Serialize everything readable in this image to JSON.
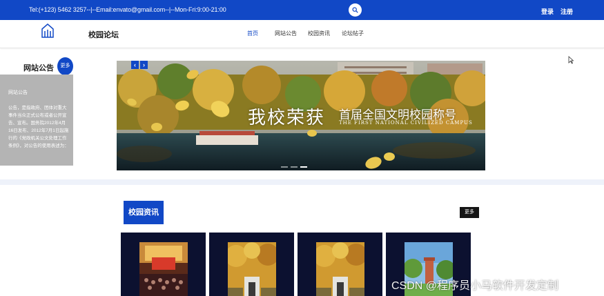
{
  "topbar": {
    "contact": "Tel:(+123) 5462 3257--|--Email:envato@gmail.com--|--Mon-Fri:9:00-21:00",
    "login": "登录",
    "register": "注册"
  },
  "header": {
    "title": "校园论坛",
    "nav": [
      "首页",
      "网站公告",
      "校园资讯",
      "论坛帖子"
    ]
  },
  "notice": {
    "heading": "网站公告",
    "more": "更多",
    "panel_title": "网站公告",
    "panel_body": "公告，是指政府、团体对重大事件当众正式公布或者公开宣告、宣布。国务院2012年4月16日发布、2012年7月1日起施行的《党政机关公文处理工作条例》，对公告的使用表述为："
  },
  "banner": {
    "cn_main": "我校荣获",
    "cn_sub": "首届全国文明校园称号",
    "en_sub": "THE FIRST NATIONAL CIVILIZED CAMPUS",
    "prev": "‹",
    "next": "›"
  },
  "news": {
    "title": "校园资讯",
    "more": "更多"
  },
  "watermark": "CSDN @程序员小马软件开发定制",
  "colors": {
    "brand": "#1148c6",
    "card_bg": "#0c1130",
    "notice_panel": "#b4b4b4"
  },
  "icons": [
    "search-icon",
    "logo-icon",
    "chevron-left-icon",
    "chevron-right-icon",
    "mouse-cursor-icon"
  ]
}
